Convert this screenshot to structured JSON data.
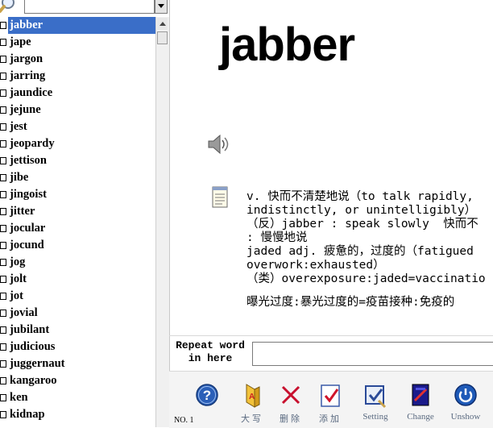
{
  "search": {
    "value": "",
    "placeholder": ""
  },
  "wordlist": [
    "jabber",
    "jape",
    "jargon",
    "jarring",
    "jaundice",
    "jejune",
    "jest",
    "jeopardy",
    "jettison",
    "jibe",
    "jingoist",
    "jitter",
    "jocular",
    "jocund",
    "jog",
    "jolt",
    "jot",
    "jovial",
    "jubilant",
    "judicious",
    "juggernaut",
    "kangaroo",
    "ken",
    "kidnap"
  ],
  "selected_word": "jabber",
  "headword": "jabber",
  "definition_lines": [
    "v. 快而不清楚地说（to talk rapidly, ",
    "indistinctly, or unintelligibly）",
    "（反）jabber : speak slowly  快而不",
    ": 慢慢地说",
    "jaded adj. 疲惫的，过度的（fatigued",
    "overwork:exhausted）",
    "（类）overexposure:jaded=vaccinatio",
    "",
    "曝光过度:暴光过度的=疫苗接种:免疫的"
  ],
  "repeat": {
    "label_line1": "Repeat word",
    "label_line2": "in here",
    "value": ""
  },
  "toolbar": {
    "help_label": "",
    "caps_label": "大写",
    "delete_label": "删除",
    "add_label": "添加",
    "setting_label": "Setting",
    "change_label": "Change",
    "unshow_label": "Unshow",
    "counter": "NO. 1"
  },
  "icons": {
    "search": "magnifier-icon",
    "speaker": "speaker-icon",
    "notes": "notepad-icon",
    "help": "question-icon",
    "caps": "caps-icon",
    "delete": "x-icon",
    "add": "add-icon",
    "setting": "setting-icon",
    "change": "change-icon",
    "unshow": "power-icon"
  },
  "colors": {
    "selection": "#3a6ec8",
    "label": "#5a6a80"
  }
}
